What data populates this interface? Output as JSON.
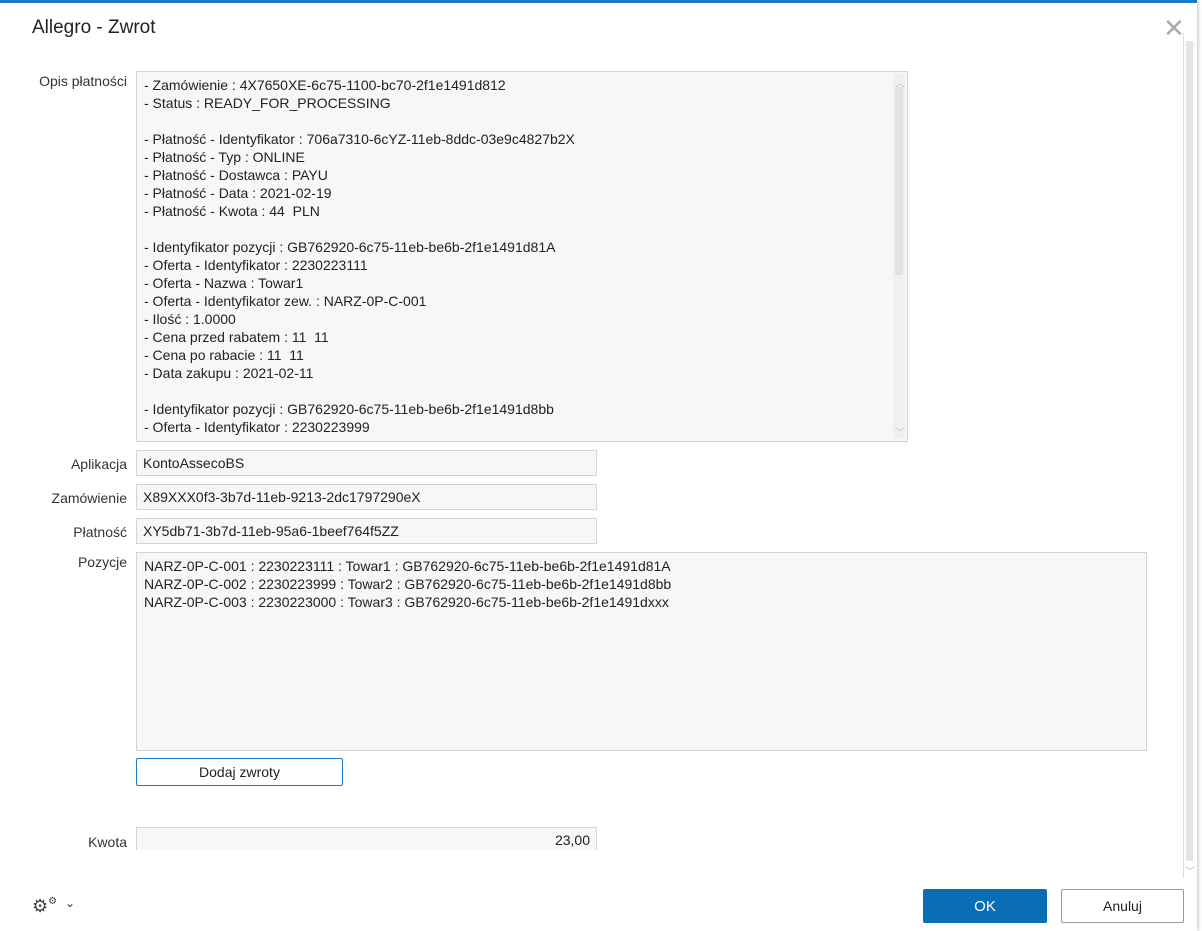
{
  "dialog": {
    "title": "Allegro - Zwrot"
  },
  "labels": {
    "opis": "Opis płatności",
    "aplikacja": "Aplikacja",
    "zamowienie": "Zamówienie",
    "platnosc": "Płatność",
    "pozycje": "Pozycje",
    "kwota": "Kwota"
  },
  "opis_lines": [
    "- Zamówienie : 4X7650XE-6c75-1100-bc70-2f1e1491d812",
    "- Status : READY_FOR_PROCESSING",
    "",
    "- Płatność - Identyfikator : 706a7310-6cYZ-11eb-8ddc-03e9c4827b2X",
    "- Płatność - Typ : ONLINE",
    "- Płatność - Dostawca : PAYU",
    "- Płatność - Data : 2021-02-19",
    "- Płatność - Kwota : 44  PLN",
    "",
    "- Identyfikator pozycji : GB762920-6c75-11eb-be6b-2f1e1491d81A",
    "- Oferta - Identyfikator : 2230223111",
    "- Oferta - Nazwa : Towar1",
    "- Oferta - Identyfikator zew. : NARZ-0P-C-001",
    "- Ilość : 1.0000",
    "- Cena przed rabatem : 11  11",
    "- Cena po rabacie : 11  11",
    "- Data zakupu : 2021-02-11",
    "",
    "- Identyfikator pozycji : GB762920-6c75-11eb-be6b-2f1e1491d8bb",
    "- Oferta - Identyfikator : 2230223999"
  ],
  "fields": {
    "aplikacja": "KontoAssecoBS",
    "zamowienie": "X89XXX0f3-3b7d-11eb-9213-2dc1797290eX",
    "platnosc": "XY5db71-3b7d-11eb-95a6-1beef764f5ZZ",
    "kwota": "23,00"
  },
  "pozycje": [
    "NARZ-0P-C-001 : 2230223111 : Towar1 : GB762920-6c75-11eb-be6b-2f1e1491d81A",
    "NARZ-0P-C-002 : 2230223999 : Towar2 : GB762920-6c75-11eb-be6b-2f1e1491d8bb",
    "NARZ-0P-C-003 : 2230223000 : Towar3 : GB762920-6c75-11eb-be6b-2f1e1491dxxx"
  ],
  "buttons": {
    "dodaj": "Dodaj zwroty",
    "ok": "OK",
    "anuluj": "Anuluj"
  },
  "colors": {
    "accent": "#0a6eb4"
  }
}
